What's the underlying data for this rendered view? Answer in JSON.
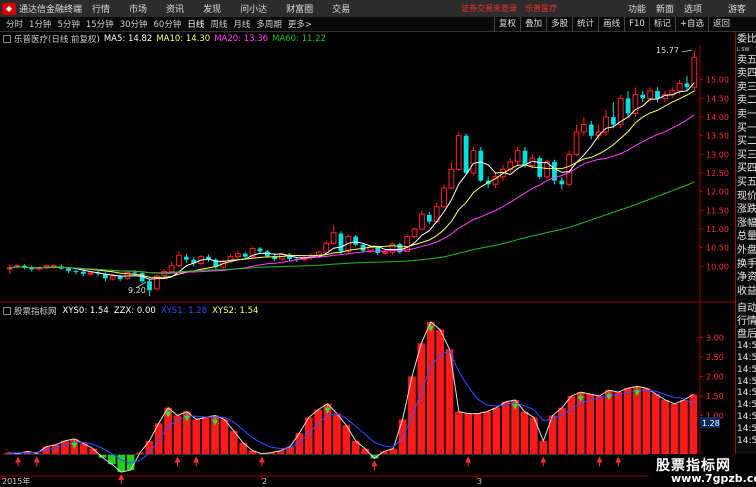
{
  "menubar": {
    "app_name": "通达信金融终端",
    "items": [
      "行情",
      "市场",
      "资讯",
      "发现",
      "问小达",
      "财富圈",
      "交易"
    ],
    "login_warning": "证券交易未登录",
    "stock_link": "乐普医疗",
    "right_items": [
      "功能",
      "新面",
      "选项"
    ],
    "guest": "游客"
  },
  "toolbar": {
    "periods": [
      "分时",
      "1分钟",
      "5分钟",
      "15分钟",
      "30分钟",
      "60分钟",
      "日线",
      "周线",
      "月线",
      "多周期",
      "更多"
    ],
    "active_period": "日线",
    "more_suffix": ">",
    "buttons": [
      "复权",
      "叠加",
      "多股",
      "统计",
      "画线",
      "F10",
      "标记",
      "+自选",
      "返回"
    ]
  },
  "main_info": {
    "title": "乐普医疗(日线 前复权)",
    "ma5": "MA5: 14.82",
    "ma10": "MA10: 14.30",
    "ma20": "MA20: 13.36",
    "ma60": "MA60: 11.22"
  },
  "indicator_info": {
    "title": "股票指标网",
    "xys0": "XYS0: 1.54",
    "zzx": "ZZX: 0.00",
    "xys1": "XYS1: 1.28",
    "xys2": "XYS2: 1.54"
  },
  "price_axis": [
    "15.00",
    "14.50",
    "14.00",
    "13.50",
    "13.00",
    "12.50",
    "12.00",
    "11.50",
    "11.00",
    "10.50",
    "10.00"
  ],
  "indicator_axis": [
    "3.00",
    "2.50",
    "2.00",
    "1.50",
    "1.00"
  ],
  "indicator_current_label": "1.28",
  "x_axis": {
    "year_label": "2015年",
    "month_labels": [
      "2",
      "3"
    ]
  },
  "annotations": {
    "high": "15.77",
    "low": "9.20"
  },
  "side_panel": {
    "top": "委比",
    "header_small": "L SW",
    "items": [
      "卖五",
      "卖四",
      "卖三",
      "卖二",
      "卖一",
      "买一",
      "买二",
      "买三",
      "买四",
      "买五",
      "现价",
      "涨跌",
      "涨幅",
      "总量",
      "外盘",
      "换手",
      "净资",
      "收益"
    ],
    "bottom": [
      "自动",
      "行情",
      "盘后",
      "14:50",
      "14:50",
      "14:50",
      "14:50",
      "14:50",
      "14:50",
      "14:50",
      "14:50",
      "14:51"
    ]
  },
  "watermark": {
    "line1": "股票指标网",
    "line2": "www.7gpzb.com"
  },
  "colors": {
    "up": "#ff2020",
    "down": "#00e0e0",
    "ma5": "#ffffff",
    "ma10": "#ffff60",
    "ma20": "#ff40ff",
    "ma60": "#20c020",
    "xys1": "#3050ff",
    "bars": "#ff1a1a"
  },
  "chart_data": [
    {
      "type": "candlestick",
      "title": "乐普医疗(日线 前复权)",
      "y_range": [
        9.2,
        15.77
      ],
      "candles": [
        [
          9.96,
          9.96,
          9.8,
          10.04
        ],
        [
          9.98,
          10.02,
          9.94,
          10.06
        ],
        [
          10.02,
          9.96,
          9.92,
          10.06
        ],
        [
          9.96,
          9.92,
          9.86,
          10.02
        ],
        [
          9.94,
          9.96,
          9.88,
          10.0
        ],
        [
          9.96,
          10.02,
          9.92,
          10.06
        ],
        [
          10.0,
          10.02,
          9.94,
          10.06
        ],
        [
          10.0,
          9.94,
          9.9,
          10.06
        ],
        [
          9.94,
          9.88,
          9.82,
          9.98
        ],
        [
          9.88,
          9.86,
          9.78,
          9.92
        ],
        [
          9.86,
          9.8,
          9.74,
          9.9
        ],
        [
          9.8,
          9.82,
          9.74,
          9.88
        ],
        [
          9.84,
          9.8,
          9.74,
          9.88
        ],
        [
          9.8,
          9.68,
          9.6,
          9.84
        ],
        [
          9.66,
          9.74,
          9.62,
          9.8
        ],
        [
          9.74,
          9.66,
          9.6,
          9.78
        ],
        [
          9.68,
          9.84,
          9.64,
          9.88
        ],
        [
          9.84,
          9.82,
          9.76,
          9.9
        ],
        [
          9.82,
          9.6,
          9.56,
          9.86
        ],
        [
          9.6,
          9.36,
          9.2,
          9.64
        ],
        [
          9.4,
          9.74,
          9.36,
          9.8
        ],
        [
          9.76,
          9.86,
          9.7,
          9.92
        ],
        [
          9.86,
          10.02,
          9.82,
          10.12
        ],
        [
          10.02,
          10.3,
          9.98,
          10.4
        ],
        [
          10.26,
          10.18,
          10.1,
          10.34
        ],
        [
          10.18,
          10.08,
          10.0,
          10.24
        ],
        [
          10.08,
          10.26,
          10.04,
          10.3
        ],
        [
          10.26,
          10.18,
          10.12,
          10.32
        ],
        [
          10.18,
          9.98,
          9.92,
          10.22
        ],
        [
          9.98,
          10.14,
          9.94,
          10.2
        ],
        [
          10.14,
          10.26,
          10.1,
          10.32
        ],
        [
          10.26,
          10.34,
          10.2,
          10.4
        ],
        [
          10.34,
          10.26,
          10.2,
          10.38
        ],
        [
          10.26,
          10.48,
          10.22,
          10.52
        ],
        [
          10.48,
          10.4,
          10.34,
          10.52
        ],
        [
          10.4,
          10.28,
          10.24,
          10.44
        ],
        [
          10.28,
          10.2,
          10.14,
          10.34
        ],
        [
          10.2,
          10.32,
          10.16,
          10.36
        ],
        [
          10.32,
          10.2,
          10.14,
          10.36
        ],
        [
          10.2,
          10.18,
          10.12,
          10.24
        ],
        [
          10.18,
          10.24,
          10.14,
          10.28
        ],
        [
          10.24,
          10.3,
          10.18,
          10.34
        ],
        [
          10.3,
          10.38,
          10.26,
          10.42
        ],
        [
          10.38,
          10.62,
          10.34,
          10.68
        ],
        [
          10.62,
          10.9,
          10.58,
          11.1
        ],
        [
          10.88,
          10.4,
          10.34,
          10.94
        ],
        [
          10.4,
          10.8,
          10.36,
          10.86
        ],
        [
          10.8,
          10.58,
          10.54,
          10.84
        ],
        [
          10.58,
          10.42,
          10.38,
          10.62
        ],
        [
          10.42,
          10.52,
          10.36,
          10.58
        ],
        [
          10.52,
          10.36,
          10.3,
          10.56
        ],
        [
          10.36,
          10.38,
          10.3,
          10.44
        ],
        [
          10.38,
          10.6,
          10.32,
          10.64
        ],
        [
          10.6,
          10.38,
          10.34,
          10.64
        ],
        [
          10.4,
          10.8,
          10.38,
          10.86
        ],
        [
          10.8,
          11.0,
          10.76,
          11.04
        ],
        [
          11.0,
          11.4,
          10.96,
          11.5
        ],
        [
          11.38,
          11.2,
          11.14,
          11.46
        ],
        [
          11.2,
          11.6,
          11.16,
          11.7
        ],
        [
          11.6,
          12.1,
          11.56,
          12.2
        ],
        [
          12.1,
          12.6,
          12.06,
          12.8
        ],
        [
          12.6,
          13.5,
          12.56,
          13.6
        ],
        [
          13.5,
          12.5,
          12.46,
          13.56
        ],
        [
          12.5,
          13.1,
          12.44,
          13.2
        ],
        [
          13.1,
          12.3,
          12.26,
          13.2
        ],
        [
          12.3,
          12.2,
          12.1,
          12.4
        ],
        [
          12.2,
          12.4,
          12.1,
          12.5
        ],
        [
          12.4,
          12.6,
          12.3,
          12.72
        ],
        [
          12.6,
          12.8,
          12.5,
          12.9
        ],
        [
          12.8,
          13.1,
          12.7,
          13.2
        ],
        [
          13.1,
          12.7,
          12.64,
          13.2
        ],
        [
          12.7,
          12.9,
          12.62,
          13.0
        ],
        [
          12.9,
          12.4,
          12.34,
          12.96
        ],
        [
          12.4,
          12.8,
          12.34,
          12.86
        ],
        [
          12.8,
          12.3,
          12.2,
          12.86
        ],
        [
          12.3,
          12.2,
          12.06,
          12.4
        ],
        [
          12.2,
          13.0,
          12.14,
          13.1
        ],
        [
          13.0,
          13.6,
          12.96,
          13.8
        ],
        [
          13.6,
          13.8,
          13.5,
          14.0
        ],
        [
          13.8,
          13.5,
          13.4,
          13.9
        ],
        [
          13.5,
          13.6,
          13.4,
          13.8
        ],
        [
          13.6,
          14.0,
          13.5,
          14.2
        ],
        [
          14.0,
          13.8,
          13.7,
          14.4
        ],
        [
          13.8,
          14.5,
          13.7,
          14.6
        ],
        [
          14.5,
          14.1,
          14.0,
          14.7
        ],
        [
          14.1,
          14.6,
          14.0,
          14.8
        ],
        [
          14.6,
          14.5,
          14.4,
          14.7
        ],
        [
          14.5,
          14.7,
          14.4,
          14.8
        ],
        [
          14.7,
          14.5,
          14.4,
          14.8
        ],
        [
          14.5,
          14.6,
          14.4,
          14.7
        ],
        [
          14.6,
          14.7,
          14.5,
          14.8
        ],
        [
          14.7,
          14.9,
          14.6,
          15.0
        ],
        [
          14.9,
          14.8,
          14.7,
          15.1
        ],
        [
          14.8,
          15.6,
          14.7,
          15.77
        ]
      ]
    },
    {
      "type": "bar",
      "title": "股票指标网",
      "y_range": [
        -0.4,
        3.4
      ],
      "values": [
        0.05,
        0.02,
        0.08,
        0.03,
        0.2,
        0.25,
        0.35,
        0.4,
        0.28,
        0.15,
        -0.08,
        -0.25,
        -0.45,
        -0.4,
        0.05,
        0.35,
        0.8,
        1.2,
        1.0,
        1.1,
        0.9,
        0.95,
        1.0,
        0.9,
        0.6,
        0.3,
        0.1,
        0.02,
        0.05,
        0.1,
        0.2,
        0.55,
        0.95,
        1.15,
        1.3,
        1.05,
        0.75,
        0.35,
        0.15,
        -0.1,
        0.08,
        0.15,
        0.9,
        2.0,
        2.85,
        3.4,
        3.2,
        2.7,
        1.1,
        1.05,
        1.05,
        1.1,
        1.2,
        1.35,
        1.4,
        1.1,
        0.95,
        0.35,
        1.0,
        1.2,
        1.5,
        1.6,
        1.55,
        1.5,
        1.65,
        1.6,
        1.7,
        1.75,
        1.7,
        1.55,
        1.4,
        1.3,
        1.4,
        1.54
      ],
      "xys1": [
        0.04,
        0.04,
        0.05,
        0.06,
        0.11,
        0.17,
        0.25,
        0.31,
        0.31,
        0.26,
        0.16,
        0.02,
        -0.14,
        -0.22,
        -0.15,
        0.03,
        0.36,
        0.72,
        0.88,
        0.99,
        0.98,
        0.96,
        0.97,
        0.95,
        0.83,
        0.63,
        0.43,
        0.29,
        0.19,
        0.15,
        0.17,
        0.31,
        0.55,
        0.8,
        1.0,
        1.04,
        0.93,
        0.72,
        0.52,
        0.31,
        0.22,
        0.19,
        0.42,
        0.97,
        1.61,
        2.24,
        2.56,
        2.66,
        2.12,
        1.74,
        1.42,
        1.27,
        1.24,
        1.28,
        1.33,
        1.25,
        1.15,
        0.87,
        0.92,
        1.01,
        1.17,
        1.32,
        1.4,
        1.45,
        1.5,
        1.53,
        1.59,
        1.63,
        1.65,
        1.62,
        1.54,
        1.46,
        1.44,
        1.28
      ]
    }
  ]
}
